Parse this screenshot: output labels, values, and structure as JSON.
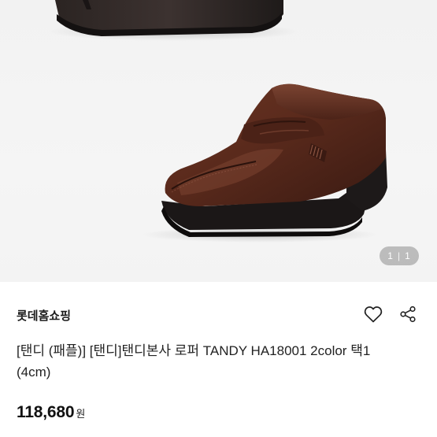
{
  "gallery": {
    "current": "1",
    "separator": "|",
    "total": "1"
  },
  "seller": {
    "name": "롯데홈쇼핑"
  },
  "product": {
    "title": "[탠디 (패플)] [탠디]탠디본사 로퍼 TANDY HA18001 2color 택1 (4cm)",
    "price": "118,680",
    "currency": "원"
  },
  "icons": {
    "like": "heart-outline-icon",
    "share": "share-icon"
  }
}
